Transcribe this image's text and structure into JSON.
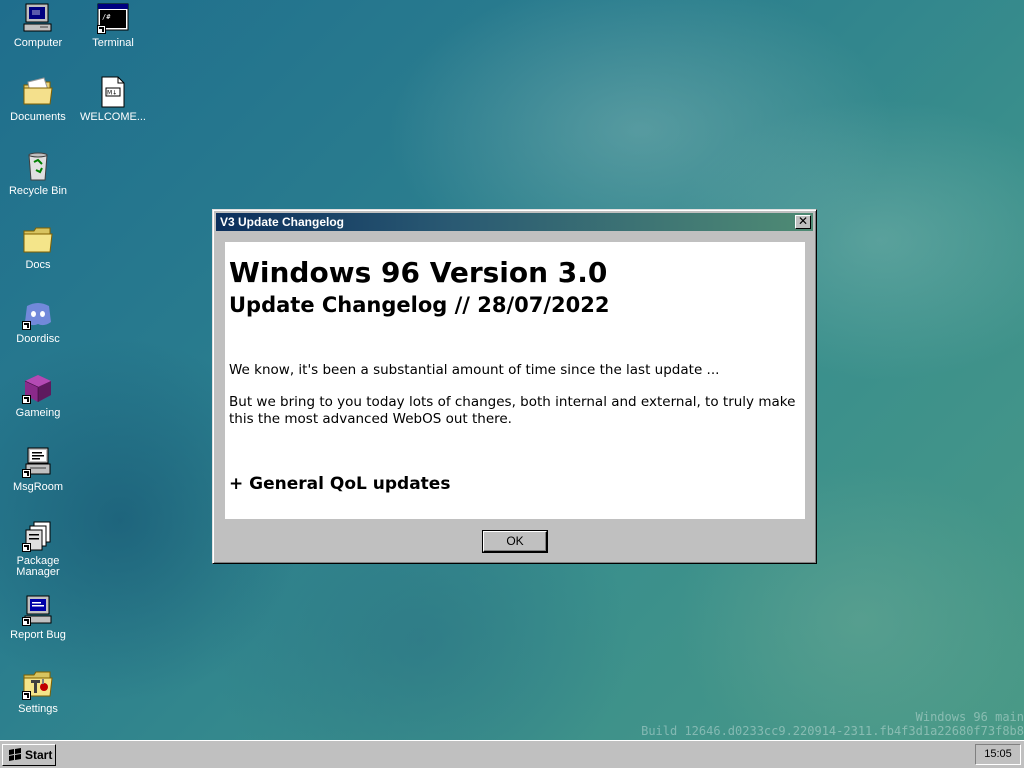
{
  "desktop": {
    "icons": [
      {
        "label": "Computer"
      },
      {
        "label": "Terminal"
      },
      {
        "label": "Documents"
      },
      {
        "label": "WELCOME..."
      },
      {
        "label": "Recycle Bin"
      },
      {
        "label": "Docs"
      },
      {
        "label": "Doordisc"
      },
      {
        "label": "Gameing"
      },
      {
        "label": "MsgRoom"
      },
      {
        "label": "Package Manager"
      },
      {
        "label": "Report Bug"
      },
      {
        "label": "Settings"
      }
    ]
  },
  "dialog": {
    "title": "V3 Update Changelog",
    "close_glyph": "✕",
    "heading": "Windows 96 Version 3.0",
    "subheading": "Update Changelog // 28/07/2022",
    "paragraphs": [
      "We know, it's been a substantial amount of time since the last update ...",
      "But we bring to you today lots of changes, both internal and external, to truly make this the most advanced WebOS out there."
    ],
    "section_heading": "+ General QoL updates",
    "ok_label": "OK"
  },
  "watermark": {
    "line1": "Windows 96 main",
    "line2": "Build 12646.d0233cc9.220914-2311.fb4f3d1a22680f73f8b8"
  },
  "taskbar": {
    "start_label": "Start",
    "clock": "15:05"
  },
  "colors": {
    "title_gradient_start": "#0c2f5c",
    "title_gradient_end": "#4f8b74",
    "window_face": "#c0c0c0"
  }
}
